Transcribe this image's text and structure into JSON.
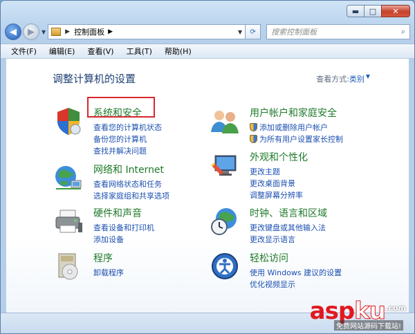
{
  "window": {
    "caption": {
      "minimize": "▬",
      "maximize": "□",
      "close": "✕"
    }
  },
  "nav": {
    "address_text": "控制面板",
    "search_placeholder": "搜索控制面板"
  },
  "menu": [
    "文件(F)",
    "编辑(E)",
    "查看(V)",
    "工具(T)",
    "帮助(H)"
  ],
  "content": {
    "title": "调整计算机的设置",
    "view_label": "查看方式:",
    "view_value": "类别"
  },
  "categories": [
    {
      "title": "系统和安全",
      "icon": "security-icon",
      "links": [
        {
          "text": "查看您的计算机状态",
          "shield": false
        },
        {
          "text": "备份您的计算机",
          "shield": false
        },
        {
          "text": "查找并解决问题",
          "shield": false
        }
      ]
    },
    {
      "title": "网络和 Internet",
      "icon": "network-icon",
      "links": [
        {
          "text": "查看网络状态和任务",
          "shield": false
        },
        {
          "text": "选择家庭组和共享选项",
          "shield": false
        }
      ]
    },
    {
      "title": "硬件和声音",
      "icon": "printer-icon",
      "links": [
        {
          "text": "查看设备和打印机",
          "shield": false
        },
        {
          "text": "添加设备",
          "shield": false
        }
      ]
    },
    {
      "title": "程序",
      "icon": "programs-icon",
      "links": [
        {
          "text": "卸载程序",
          "shield": false
        }
      ]
    },
    {
      "title": "用户帐户和家庭安全",
      "icon": "users-icon",
      "links": [
        {
          "text": "添加或删除用户帐户",
          "shield": true
        },
        {
          "text": "为所有用户设置家长控制",
          "shield": true
        }
      ]
    },
    {
      "title": "外观和个性化",
      "icon": "appearance-icon",
      "links": [
        {
          "text": "更改主题",
          "shield": false
        },
        {
          "text": "更改桌面背景",
          "shield": false
        },
        {
          "text": "调整屏幕分辨率",
          "shield": false
        }
      ]
    },
    {
      "title": "时钟、语言和区域",
      "icon": "clock-globe-icon",
      "links": [
        {
          "text": "更改键盘或其他输入法",
          "shield": false
        },
        {
          "text": "更改显示语言",
          "shield": false
        }
      ]
    },
    {
      "title": "轻松访问",
      "icon": "accessibility-icon",
      "links": [
        {
          "text": "使用 Windows 建议的设置",
          "shield": false
        },
        {
          "text": "优化视频显示",
          "shield": false
        }
      ]
    }
  ],
  "watermark": {
    "main_a": "asp",
    "main_k": "ku",
    "com": ".com",
    "sub": "免费网站源码下载站!"
  },
  "colors": {
    "category_title": "#1f7a2a",
    "link": "#1c4fb0",
    "highlight": "#d8262e"
  }
}
